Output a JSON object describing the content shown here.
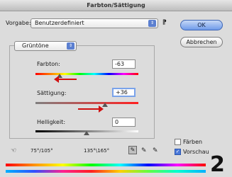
{
  "window": {
    "title": "Farbton/Sättigung"
  },
  "preset": {
    "label": "Vorgabe:",
    "value": "Benutzerdefiniert",
    "options_icon": "preset-options-icon",
    "options_glyph": "⁋"
  },
  "buttons": {
    "ok": "OK",
    "cancel": "Abbrechen"
  },
  "channel": {
    "value": "Grüntöne"
  },
  "hue": {
    "label": "Farbton:",
    "value": "-63"
  },
  "saturation": {
    "label": "Sättigung:",
    "value": "+36"
  },
  "lightness": {
    "label": "Helligkeit:",
    "value": "0"
  },
  "range": {
    "left": "75°/105°",
    "right": "135°\\165°"
  },
  "checkboxes": {
    "colorize": {
      "label": "Färben",
      "checked": false
    },
    "preview": {
      "label": "Vorschau",
      "checked": true
    }
  },
  "annotation": {
    "page_number": "2",
    "arrow_color": "#d01010"
  },
  "icons": {
    "stepper": "⇕",
    "check": "✓",
    "hand": "☜",
    "eyedropper": "✎",
    "eyedropper_plus": "✎",
    "eyedropper_minus": "✎"
  }
}
